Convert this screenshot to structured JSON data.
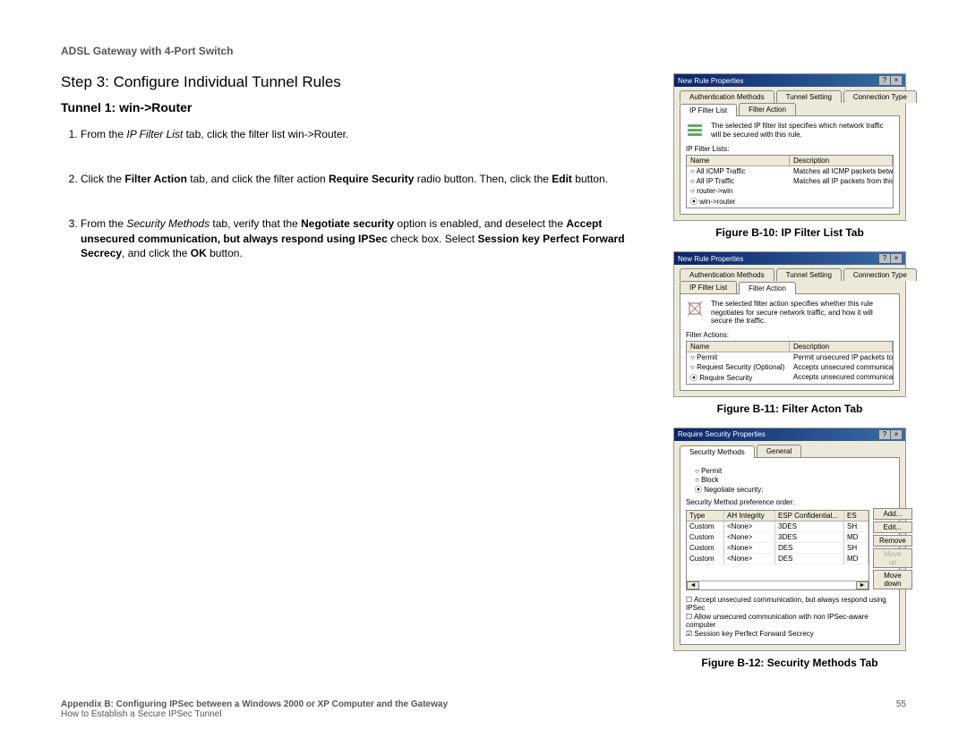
{
  "header": {
    "product": "ADSL Gateway with 4-Port Switch"
  },
  "step": {
    "title": "Step 3: Configure Individual Tunnel Rules",
    "tunnel": "Tunnel 1: win->Router"
  },
  "items": [
    {
      "pre": "From the ",
      "italic1": "IP Filter List",
      "mid1": " tab, click the filter list win->Router."
    },
    {
      "pre": "Click the ",
      "b1": "Filter Action",
      "mid1": " tab, and click the filter action ",
      "b2": "Require Security",
      "mid2": " radio button. Then, click the ",
      "b3": "Edit",
      "mid3": " button."
    },
    {
      "pre": "From the ",
      "italic1": "Security Methods",
      "mid1": " tab, verify that the ",
      "b1": "Negotiate security",
      "mid2": " option is enabled, and deselect the ",
      "b2": "Accept unsecured communication, but always respond using IPSec",
      "mid3": " check box. Select ",
      "b3": "Session key Perfect Forward Secrecy",
      "mid4": ", and click the ",
      "b4": "OK",
      "mid5": " button."
    }
  ],
  "figures": {
    "b10": {
      "caption": "Figure B-10: IP Filter List Tab",
      "title": "New Rule Properties",
      "tabs": [
        "Authentication Methods",
        "Tunnel Setting",
        "Connection Type"
      ],
      "tabs2": [
        "IP Filter List",
        "Filter Action"
      ],
      "desc": "The selected IP filter list specifies which network traffic will be secured with this rule.",
      "section": "IP Filter Lists:",
      "cols": [
        "Name",
        "Description"
      ],
      "rows": [
        [
          "All ICMP Traffic",
          "Matches all ICMP packets betw..."
        ],
        [
          "All IP Traffic",
          "Matches all IP packets from this ..."
        ],
        [
          "router->win",
          ""
        ],
        [
          "win->router",
          ""
        ]
      ]
    },
    "b11": {
      "caption": "Figure B-11: Filter Acton Tab",
      "title": "New Rule Properties",
      "tabs": [
        "Authentication Methods",
        "Tunnel Setting",
        "Connection Type"
      ],
      "tabs2": [
        "IP Filter List",
        "Filter Action"
      ],
      "desc": "The selected filter action specifies whether this rule negotiates for secure network traffic, and how it will secure the traffic.",
      "section": "Filter Actions:",
      "cols": [
        "Name",
        "Description"
      ],
      "rows": [
        [
          "Permit",
          "Permit unsecured IP packets to ..."
        ],
        [
          "Request Security (Optional)",
          "Accepts unsecured communicat..."
        ],
        [
          "Require Security",
          "Accepts unsecured communicat..."
        ]
      ]
    },
    "b12": {
      "caption": "Figure B-12: Security Methods Tab",
      "title": "Require Security Properties",
      "tabs": [
        "Security Methods",
        "General"
      ],
      "radios": [
        "Permit",
        "Block",
        "Negotiate security:"
      ],
      "prefLabel": "Security Method preference order:",
      "cols": [
        "Type",
        "AH Integrity",
        "ESP Confidential...",
        "ES"
      ],
      "rows": [
        [
          "Custom",
          "<None>",
          "3DES",
          "SH"
        ],
        [
          "Custom",
          "<None>",
          "3DES",
          "MD"
        ],
        [
          "Custom",
          "<None>",
          "DES",
          "SH"
        ],
        [
          "Custom",
          "<None>",
          "DES",
          "MD"
        ]
      ],
      "buttons": [
        "Add...",
        "Edit...",
        "Remove",
        "Move up",
        "Move down"
      ],
      "checks": [
        "Accept unsecured communication, but always respond using IPSec",
        "Allow unsecured communication with non IPSec-aware computer",
        "Session key Perfect Forward Secrecy"
      ]
    }
  },
  "footer": {
    "l1": "Appendix B: Configuring IPSec between a Windows 2000 or XP Computer and the Gateway",
    "l2": "How to Establish a Secure IPSec Tunnel",
    "page": "55"
  }
}
